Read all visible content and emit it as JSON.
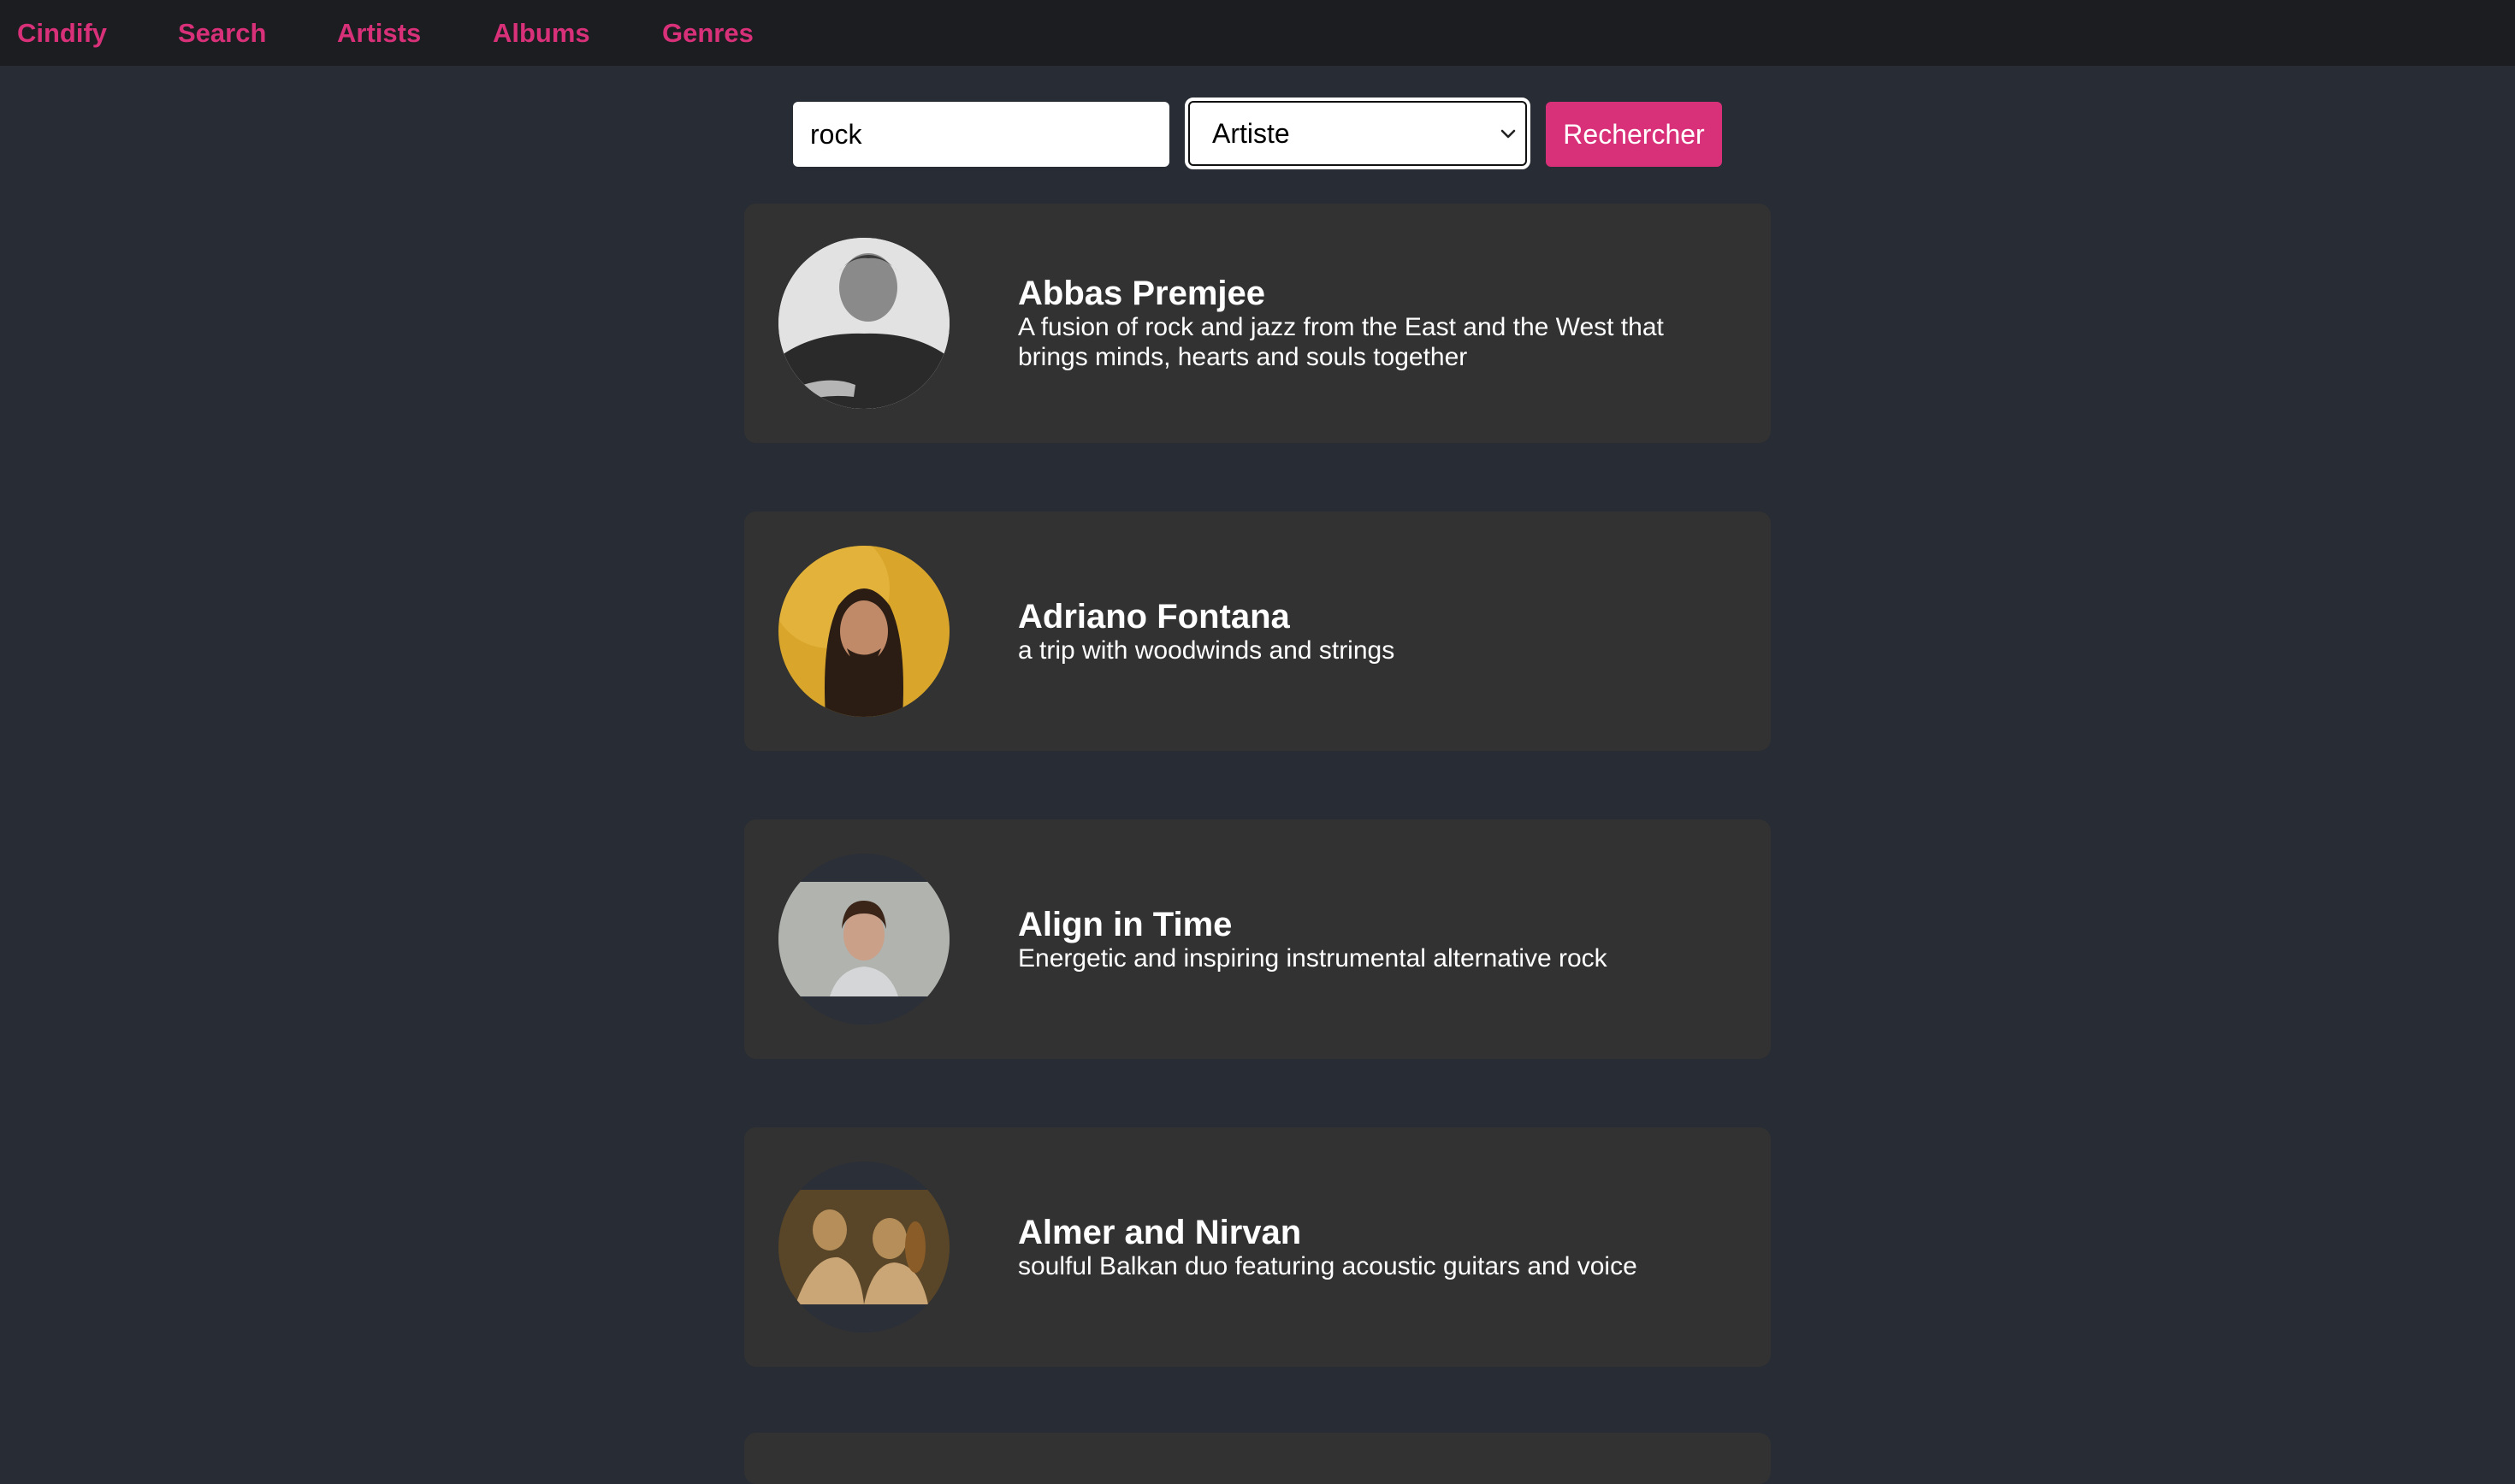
{
  "nav": {
    "items": [
      {
        "label": "Cindify"
      },
      {
        "label": "Search"
      },
      {
        "label": "Artists"
      },
      {
        "label": "Albums"
      },
      {
        "label": "Genres"
      }
    ]
  },
  "search": {
    "query_value": "rock",
    "type_selected": "Artiste",
    "button_label": "Rechercher"
  },
  "results": [
    {
      "name": "Abbas Premjee",
      "description": "A fusion of rock and jazz from the East and the West that brings minds, hearts and souls together"
    },
    {
      "name": "Adriano Fontana",
      "description": "a trip with woodwinds and strings"
    },
    {
      "name": "Align in Time",
      "description": "Energetic and inspiring instrumental alternative rock"
    },
    {
      "name": "Almer and Nirvan",
      "description": "soulful Balkan duo featuring acoustic guitars and voice"
    }
  ],
  "colors": {
    "accent": "#d9307a",
    "navbar_bg": "#1c1d20",
    "page_bg": "#282c34",
    "card_bg": "#323232"
  }
}
